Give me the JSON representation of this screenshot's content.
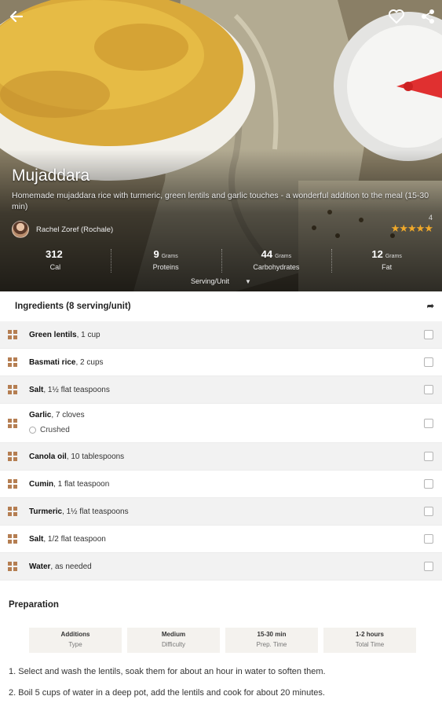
{
  "recipe": {
    "title": "Mujaddara",
    "description": "Homemade mujaddara rice with turmeric, green lentils and garlic touches - a wonderful addition to the meal (15-30 min)",
    "author": "Rachel Zoref (Rochale)",
    "rating_count": "4",
    "rating_value": 5
  },
  "nutrition": [
    {
      "value": "312",
      "unit": "",
      "label": "Cal"
    },
    {
      "value": "9",
      "unit": "Grams",
      "label": "Proteins"
    },
    {
      "value": "44",
      "unit": "Grams",
      "label": "Carbohydrates"
    },
    {
      "value": "12",
      "unit": "Grams",
      "label": "Fat"
    }
  ],
  "serving_unit_label": "Serving/Unit",
  "ingredients_header": "Ingredients (8 serving/unit)",
  "ingredients": [
    {
      "name": "Green lentils",
      "amount": ", 1 cup"
    },
    {
      "name": "Basmati rice",
      "amount": ", 2 cups"
    },
    {
      "name": "Salt",
      "amount": ", 1½ flat teaspoons"
    },
    {
      "name": "Garlic",
      "amount": ", 7 cloves",
      "note": "Crushed"
    },
    {
      "name": "Canola oil",
      "amount": ", 10 tablespoons"
    },
    {
      "name": "Cumin",
      "amount": ", 1 flat teaspoon"
    },
    {
      "name": "Turmeric",
      "amount": ", 1½ flat teaspoons"
    },
    {
      "name": "Salt",
      "amount": ", 1/2 flat teaspoon"
    },
    {
      "name": "Water",
      "amount": ", as needed"
    }
  ],
  "preparation_title": "Preparation",
  "info": [
    {
      "value": "Additions",
      "label": "Type"
    },
    {
      "value": "Medium",
      "label": "Difficulty"
    },
    {
      "value": "15-30 min",
      "label": "Prep. Time"
    },
    {
      "value": "1-2 hours",
      "label": "Total Time"
    }
  ],
  "steps": [
    "1. Select and wash the lentils, soak them for about an hour in water to soften them.",
    "2. Boil 5 cups of water in a deep pot, add the lentils and cook for about 20 minutes."
  ],
  "colors": {
    "accent": "#b57e52",
    "star": "#f0a92a"
  }
}
